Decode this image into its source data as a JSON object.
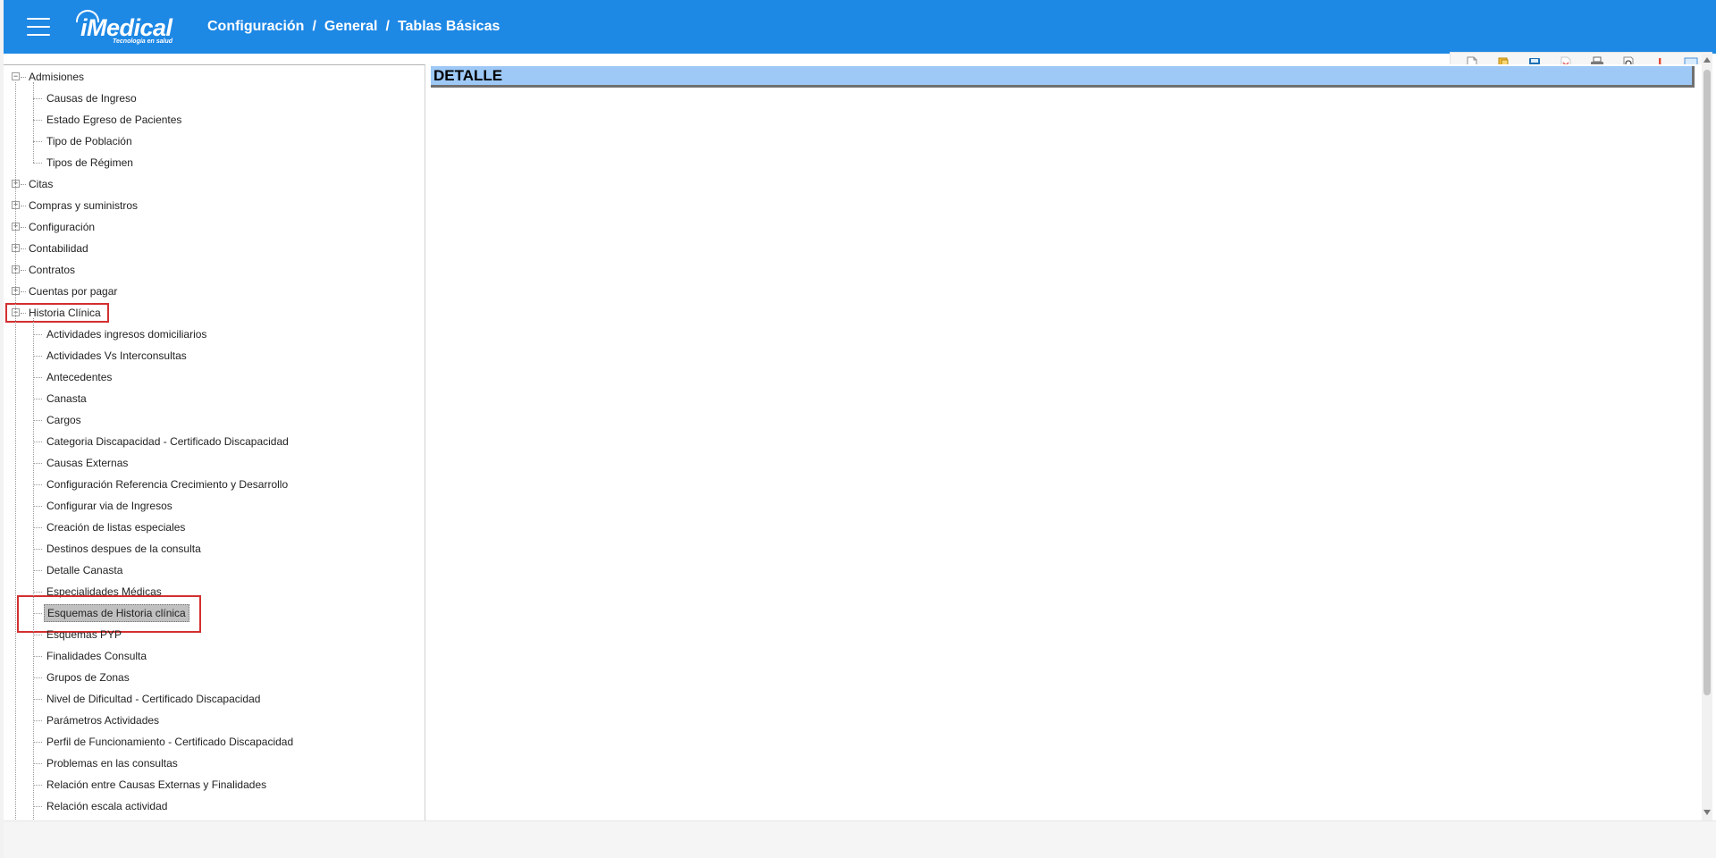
{
  "header": {
    "logo_text": "iMedical",
    "logo_tagline": "Tecnología en salud",
    "breadcrumb": [
      "Configuración",
      "General",
      "Tablas Básicas"
    ],
    "separator": "/"
  },
  "toolbar": {
    "icons": [
      "new-document-icon",
      "folder-icon",
      "save-icon",
      "delete-icon",
      "print-icon",
      "preview-icon",
      "alert-icon",
      "comment-icon"
    ]
  },
  "tree": {
    "nodes": [
      {
        "label": "Admisiones",
        "level": 0,
        "expanded": true
      },
      {
        "label": "Causas de Ingreso",
        "level": 1
      },
      {
        "label": "Estado Egreso de Pacientes",
        "level": 1
      },
      {
        "label": "Tipo de Población",
        "level": 1
      },
      {
        "label": "Tipos de Régimen",
        "level": 1
      },
      {
        "label": "Citas",
        "level": 0,
        "expanded": false
      },
      {
        "label": "Compras y suministros",
        "level": 0,
        "expanded": false
      },
      {
        "label": "Configuración",
        "level": 0,
        "expanded": false
      },
      {
        "label": "Contabilidad",
        "level": 0,
        "expanded": false
      },
      {
        "label": "Contratos",
        "level": 0,
        "expanded": false
      },
      {
        "label": "Cuentas por pagar",
        "level": 0,
        "expanded": false
      },
      {
        "label": "Historia Clínica",
        "level": 0,
        "expanded": true,
        "boxed": true
      },
      {
        "label": "Actividades ingresos domiciliarios",
        "level": 1
      },
      {
        "label": "Actividades Vs Interconsultas",
        "level": 1
      },
      {
        "label": "Antecedentes",
        "level": 1
      },
      {
        "label": "Canasta",
        "level": 1
      },
      {
        "label": "Cargos",
        "level": 1
      },
      {
        "label": "Categoria Discapacidad - Certificado Discapacidad",
        "level": 1
      },
      {
        "label": "Causas Externas",
        "level": 1
      },
      {
        "label": "Configuración Referencia Crecimiento y Desarrollo",
        "level": 1
      },
      {
        "label": "Configurar via de Ingresos",
        "level": 1
      },
      {
        "label": "Creación de listas especiales",
        "level": 1
      },
      {
        "label": "Destinos despues de la consulta",
        "level": 1
      },
      {
        "label": "Detalle Canasta",
        "level": 1
      },
      {
        "label": "Especialidades Médicas",
        "level": 1
      },
      {
        "label": "Esquemas de Historia clínica",
        "level": 1,
        "selected": true,
        "boxed": true
      },
      {
        "label": "Esquemas PYP",
        "level": 1
      },
      {
        "label": "Finalidades Consulta",
        "level": 1
      },
      {
        "label": "Grupos de Zonas",
        "level": 1
      },
      {
        "label": "Nivel de Dificultad - Certificado Discapacidad",
        "level": 1
      },
      {
        "label": "Parámetros Actividades",
        "level": 1
      },
      {
        "label": "Perfil de Funcionamiento - Certificado Discapacidad",
        "level": 1
      },
      {
        "label": "Problemas en las consultas",
        "level": 1
      },
      {
        "label": "Relación entre Causas Externas y Finalidades",
        "level": 1
      },
      {
        "label": "Relación escala actividad",
        "level": 1
      }
    ]
  },
  "detail": {
    "title": "DETALLE"
  },
  "colors": {
    "header_bg": "#1e88e5",
    "detail_bar": "#9ec9f7",
    "highlight_border": "#d32f2f"
  }
}
